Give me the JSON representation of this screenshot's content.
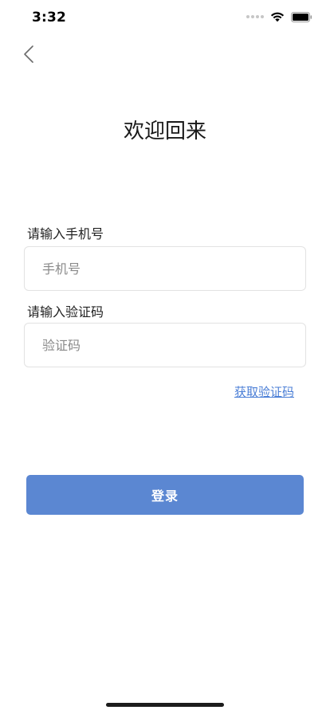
{
  "status_bar": {
    "time": "3:32"
  },
  "header": {
    "title": "欢迎回来"
  },
  "phone": {
    "label": "请输入手机号",
    "placeholder": "手机号",
    "value": ""
  },
  "code": {
    "label": "请输入验证码",
    "placeholder": "验证码",
    "value": ""
  },
  "get_code_label": "获取验证码",
  "login_label": "登录",
  "colors": {
    "accent": "#5b87d2",
    "link": "#4a7ed6",
    "input_border": "#e2e2e2"
  },
  "icons": {
    "back": "chevron-left-icon",
    "wifi": "wifi-icon",
    "battery": "battery-icon",
    "signal": "cellular-signal-icon"
  }
}
